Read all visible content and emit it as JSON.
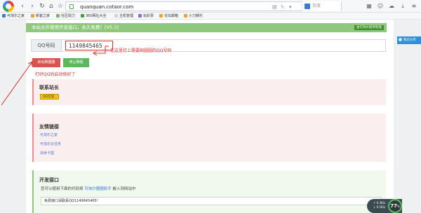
{
  "browser": {
    "url": "quanquan.cotaor.com",
    "search_placeholder": "百度",
    "nav": {
      "back": "‹",
      "forward": "›",
      "reload": "↻",
      "home": "⌂",
      "star": "☆"
    }
  },
  "bookmarks": [
    {
      "label": "可淘尔之家",
      "icon_color": "#3b7bd8"
    },
    {
      "label": "新客之家",
      "icon_color": "#f0a02c"
    },
    {
      "label": "社区助力",
      "icon_color": "#7bb661"
    },
    {
      "label": "360网址大全",
      "icon_color": "#3aa635"
    },
    {
      "label": "主机管理",
      "icon_color": "#cfd3d8"
    },
    {
      "label": "玩彩票",
      "icon_color": "#8f6ad6"
    },
    {
      "label": "论坛邮箱",
      "icon_color": "#f0a02c"
    },
    {
      "label": "小刀娱乐",
      "icon_color": "#f0a02c"
    }
  ],
  "notice": {
    "text": "本站允许使用开发接口，永久免费！[V5.3]",
    "button": "由可淘尔提供智能"
  },
  "qq_form": {
    "label": "QQ号码",
    "value": "1149845465",
    "annotation": "在这里打上需要刷圈圈的QQ号码"
  },
  "actions": {
    "start": "启动刷圈圈",
    "stop": "停止刷程",
    "annotation": "打好QQ后启动就好了"
  },
  "contact": {
    "title": "联系站长",
    "badge": "QQ交谈"
  },
  "friends": {
    "title": "友情链接",
    "links": [
      "可淘尔之家",
      "可淘尔云任务",
      "淘米卡盟"
    ]
  },
  "dev": {
    "title": "开发接口",
    "desc_prefix": "您可以使用下面的代码将",
    "desc_link": "可淘尔圈圈助手",
    "desc_suffix": "嵌入到网站中",
    "code": "免费接口请联系QQ1149845465！"
  },
  "share": {
    "label": "我已分享"
  },
  "speed": {
    "up": "↑ 0.3K/s",
    "down": "↓ 0.1K/s",
    "percent": "77",
    "unit": "%"
  },
  "colors": {
    "accent_green": "#8fc87d",
    "alert_red": "#e0302b",
    "danger": "#d9534f",
    "success": "#5cb85c",
    "link": "#3b7bd8"
  }
}
